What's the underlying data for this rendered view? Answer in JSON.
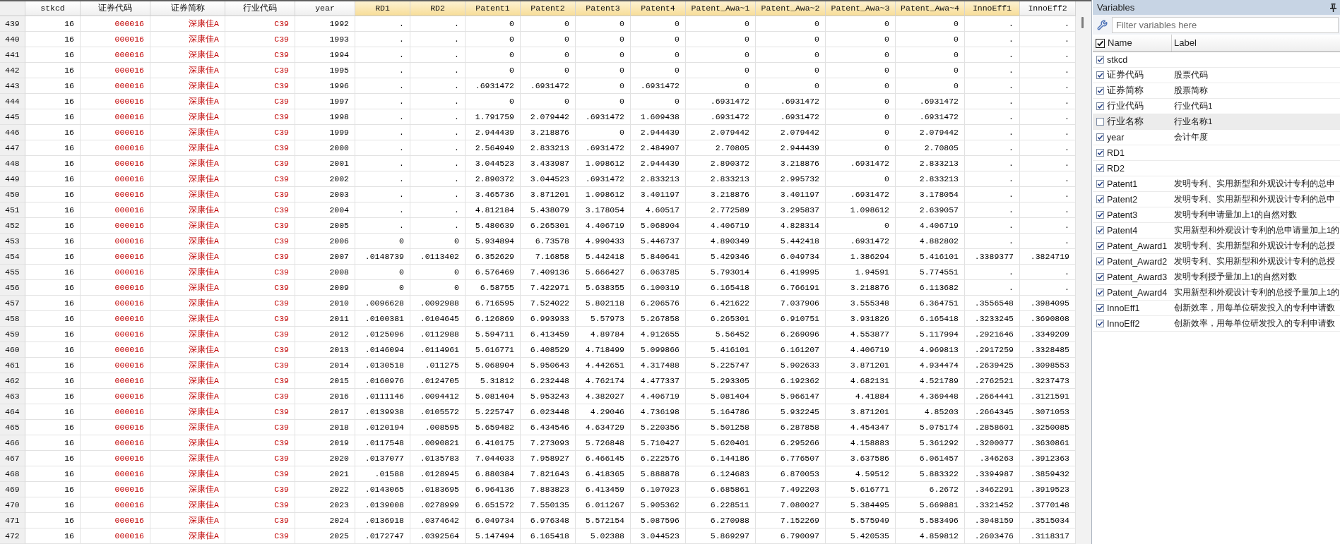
{
  "data_editor": {
    "columns": [
      {
        "name": "stkcd",
        "kind": "numeric",
        "selected": false
      },
      {
        "name": "证券代码",
        "kind": "string",
        "selected": false
      },
      {
        "name": "证券简称",
        "kind": "string",
        "selected": false
      },
      {
        "name": "行业代码",
        "kind": "string",
        "selected": false
      },
      {
        "name": "year",
        "kind": "numeric",
        "selected": false
      },
      {
        "name": "RD1",
        "kind": "numeric",
        "selected": true
      },
      {
        "name": "RD2",
        "kind": "numeric",
        "selected": true
      },
      {
        "name": "Patent1",
        "kind": "numeric",
        "selected": true
      },
      {
        "name": "Patent2",
        "kind": "numeric",
        "selected": true
      },
      {
        "name": "Patent3",
        "kind": "numeric",
        "selected": true
      },
      {
        "name": "Patent4",
        "kind": "numeric",
        "selected": true
      },
      {
        "name": "Patent_Awa~1",
        "kind": "numeric",
        "selected": true
      },
      {
        "name": "Patent_Awa~2",
        "kind": "numeric",
        "selected": true
      },
      {
        "name": "Patent_Awa~3",
        "kind": "numeric",
        "selected": true
      },
      {
        "name": "Patent_Awa~4",
        "kind": "numeric",
        "selected": true
      },
      {
        "name": "InnoEff1",
        "kind": "numeric",
        "selected": true
      },
      {
        "name": "InnoEff2",
        "kind": "numeric",
        "selected": false
      }
    ],
    "rows": [
      {
        "number": "439",
        "cells": [
          "16",
          "000016",
          "深康佳A",
          "C39",
          "1992",
          ".",
          ".",
          "0",
          "0",
          "0",
          "0",
          "0",
          "0",
          "0",
          "0",
          ".",
          "."
        ]
      },
      {
        "number": "440",
        "cells": [
          "16",
          "000016",
          "深康佳A",
          "C39",
          "1993",
          ".",
          ".",
          "0",
          "0",
          "0",
          "0",
          "0",
          "0",
          "0",
          "0",
          ".",
          "."
        ]
      },
      {
        "number": "441",
        "cells": [
          "16",
          "000016",
          "深康佳A",
          "C39",
          "1994",
          ".",
          ".",
          "0",
          "0",
          "0",
          "0",
          "0",
          "0",
          "0",
          "0",
          ".",
          "."
        ]
      },
      {
        "number": "442",
        "cells": [
          "16",
          "000016",
          "深康佳A",
          "C39",
          "1995",
          ".",
          ".",
          "0",
          "0",
          "0",
          "0",
          "0",
          "0",
          "0",
          "0",
          ".",
          "."
        ]
      },
      {
        "number": "443",
        "cells": [
          "16",
          "000016",
          "深康佳A",
          "C39",
          "1996",
          ".",
          ".",
          ".6931472",
          ".6931472",
          "0",
          ".6931472",
          "0",
          "0",
          "0",
          "0",
          ".",
          "."
        ]
      },
      {
        "number": "444",
        "cells": [
          "16",
          "000016",
          "深康佳A",
          "C39",
          "1997",
          ".",
          ".",
          "0",
          "0",
          "0",
          "0",
          ".6931472",
          ".6931472",
          "0",
          ".6931472",
          ".",
          "."
        ]
      },
      {
        "number": "445",
        "cells": [
          "16",
          "000016",
          "深康佳A",
          "C39",
          "1998",
          ".",
          ".",
          "1.791759",
          "2.079442",
          ".6931472",
          "1.609438",
          ".6931472",
          ".6931472",
          "0",
          ".6931472",
          ".",
          "."
        ]
      },
      {
        "number": "446",
        "cells": [
          "16",
          "000016",
          "深康佳A",
          "C39",
          "1999",
          ".",
          ".",
          "2.944439",
          "3.218876",
          "0",
          "2.944439",
          "2.079442",
          "2.079442",
          "0",
          "2.079442",
          ".",
          "."
        ]
      },
      {
        "number": "447",
        "cells": [
          "16",
          "000016",
          "深康佳A",
          "C39",
          "2000",
          ".",
          ".",
          "2.564949",
          "2.833213",
          ".6931472",
          "2.484907",
          "2.70805",
          "2.944439",
          "0",
          "2.70805",
          ".",
          "."
        ]
      },
      {
        "number": "448",
        "cells": [
          "16",
          "000016",
          "深康佳A",
          "C39",
          "2001",
          ".",
          ".",
          "3.044523",
          "3.433987",
          "1.098612",
          "2.944439",
          "2.890372",
          "3.218876",
          ".6931472",
          "2.833213",
          ".",
          "."
        ]
      },
      {
        "number": "449",
        "cells": [
          "16",
          "000016",
          "深康佳A",
          "C39",
          "2002",
          ".",
          ".",
          "2.890372",
          "3.044523",
          ".6931472",
          "2.833213",
          "2.833213",
          "2.995732",
          "0",
          "2.833213",
          ".",
          "."
        ]
      },
      {
        "number": "450",
        "cells": [
          "16",
          "000016",
          "深康佳A",
          "C39",
          "2003",
          ".",
          ".",
          "3.465736",
          "3.871201",
          "1.098612",
          "3.401197",
          "3.218876",
          "3.401197",
          ".6931472",
          "3.178054",
          ".",
          "."
        ]
      },
      {
        "number": "451",
        "cells": [
          "16",
          "000016",
          "深康佳A",
          "C39",
          "2004",
          ".",
          ".",
          "4.812184",
          "5.438079",
          "3.178054",
          "4.60517",
          "2.772589",
          "3.295837",
          "1.098612",
          "2.639057",
          ".",
          "."
        ]
      },
      {
        "number": "452",
        "cells": [
          "16",
          "000016",
          "深康佳A",
          "C39",
          "2005",
          ".",
          ".",
          "5.480639",
          "6.265301",
          "4.406719",
          "5.068904",
          "4.406719",
          "4.828314",
          "0",
          "4.406719",
          ".",
          "."
        ]
      },
      {
        "number": "453",
        "cells": [
          "16",
          "000016",
          "深康佳A",
          "C39",
          "2006",
          "0",
          "0",
          "5.934894",
          "6.73578",
          "4.990433",
          "5.446737",
          "4.890349",
          "5.442418",
          ".6931472",
          "4.882802",
          ".",
          "."
        ]
      },
      {
        "number": "454",
        "cells": [
          "16",
          "000016",
          "深康佳A",
          "C39",
          "2007",
          ".0148739",
          ".0113402",
          "6.352629",
          "7.16858",
          "5.442418",
          "5.840641",
          "5.429346",
          "6.049734",
          "1.386294",
          "5.416101",
          ".3389377",
          ".3824719"
        ]
      },
      {
        "number": "455",
        "cells": [
          "16",
          "000016",
          "深康佳A",
          "C39",
          "2008",
          "0",
          "0",
          "6.576469",
          "7.409136",
          "5.666427",
          "6.063785",
          "5.793014",
          "6.419995",
          "1.94591",
          "5.774551",
          ".",
          "."
        ]
      },
      {
        "number": "456",
        "cells": [
          "16",
          "000016",
          "深康佳A",
          "C39",
          "2009",
          "0",
          "0",
          "6.58755",
          "7.422971",
          "5.638355",
          "6.100319",
          "6.165418",
          "6.766191",
          "3.218876",
          "6.113682",
          ".",
          "."
        ]
      },
      {
        "number": "457",
        "cells": [
          "16",
          "000016",
          "深康佳A",
          "C39",
          "2010",
          ".0096628",
          ".0092988",
          "6.716595",
          "7.524022",
          "5.802118",
          "6.206576",
          "6.421622",
          "7.037906",
          "3.555348",
          "6.364751",
          ".3556548",
          ".3984095"
        ]
      },
      {
        "number": "458",
        "cells": [
          "16",
          "000016",
          "深康佳A",
          "C39",
          "2011",
          ".0100381",
          ".0104645",
          "6.126869",
          "6.993933",
          "5.57973",
          "5.267858",
          "6.265301",
          "6.910751",
          "3.931826",
          "6.165418",
          ".3233245",
          ".3690808"
        ]
      },
      {
        "number": "459",
        "cells": [
          "16",
          "000016",
          "深康佳A",
          "C39",
          "2012",
          ".0125096",
          ".0112988",
          "5.594711",
          "6.413459",
          "4.89784",
          "4.912655",
          "5.56452",
          "6.269096",
          "4.553877",
          "5.117994",
          ".2921646",
          ".3349209"
        ]
      },
      {
        "number": "460",
        "cells": [
          "16",
          "000016",
          "深康佳A",
          "C39",
          "2013",
          ".0146094",
          ".0114961",
          "5.616771",
          "6.408529",
          "4.718499",
          "5.099866",
          "5.416101",
          "6.161207",
          "4.406719",
          "4.969813",
          ".2917259",
          ".3328485"
        ]
      },
      {
        "number": "461",
        "cells": [
          "16",
          "000016",
          "深康佳A",
          "C39",
          "2014",
          ".0130518",
          ".011275",
          "5.068904",
          "5.950643",
          "4.442651",
          "4.317488",
          "5.225747",
          "5.902633",
          "3.871201",
          "4.934474",
          ".2639425",
          ".3098553"
        ]
      },
      {
        "number": "462",
        "cells": [
          "16",
          "000016",
          "深康佳A",
          "C39",
          "2015",
          ".0160976",
          ".0124705",
          "5.31812",
          "6.232448",
          "4.762174",
          "4.477337",
          "5.293305",
          "6.192362",
          "4.682131",
          "4.521789",
          ".2762521",
          ".3237473"
        ]
      },
      {
        "number": "463",
        "cells": [
          "16",
          "000016",
          "深康佳A",
          "C39",
          "2016",
          ".0111146",
          ".0094412",
          "5.081404",
          "5.953243",
          "4.382027",
          "4.406719",
          "5.081404",
          "5.966147",
          "4.41884",
          "4.369448",
          ".2664441",
          ".3121591"
        ]
      },
      {
        "number": "464",
        "cells": [
          "16",
          "000016",
          "深康佳A",
          "C39",
          "2017",
          ".0139938",
          ".0105572",
          "5.225747",
          "6.023448",
          "4.29046",
          "4.736198",
          "5.164786",
          "5.932245",
          "3.871201",
          "4.85203",
          ".2664345",
          ".3071053"
        ]
      },
      {
        "number": "465",
        "cells": [
          "16",
          "000016",
          "深康佳A",
          "C39",
          "2018",
          ".0120194",
          ".008595",
          "5.659482",
          "6.434546",
          "4.634729",
          "5.220356",
          "5.501258",
          "6.287858",
          "4.454347",
          "5.075174",
          ".2858601",
          ".3250085"
        ]
      },
      {
        "number": "466",
        "cells": [
          "16",
          "000016",
          "深康佳A",
          "C39",
          "2019",
          ".0117548",
          ".0090821",
          "6.410175",
          "7.273093",
          "5.726848",
          "5.710427",
          "5.620401",
          "6.295266",
          "4.158883",
          "5.361292",
          ".3200077",
          ".3630861"
        ]
      },
      {
        "number": "467",
        "cells": [
          "16",
          "000016",
          "深康佳A",
          "C39",
          "2020",
          ".0137077",
          ".0135783",
          "7.044033",
          "7.958927",
          "6.466145",
          "6.222576",
          "6.144186",
          "6.776507",
          "3.637586",
          "6.061457",
          ".346263",
          ".3912363"
        ]
      },
      {
        "number": "468",
        "cells": [
          "16",
          "000016",
          "深康佳A",
          "C39",
          "2021",
          ".01588",
          ".0128945",
          "6.880384",
          "7.821643",
          "6.418365",
          "5.888878",
          "6.124683",
          "6.870053",
          "4.59512",
          "5.883322",
          ".3394987",
          ".3859432"
        ]
      },
      {
        "number": "469",
        "cells": [
          "16",
          "000016",
          "深康佳A",
          "C39",
          "2022",
          ".0143065",
          ".0183695",
          "6.964136",
          "7.883823",
          "6.413459",
          "6.107023",
          "6.685861",
          "7.492203",
          "5.616771",
          "6.2672",
          ".3462291",
          ".3919523"
        ]
      },
      {
        "number": "470",
        "cells": [
          "16",
          "000016",
          "深康佳A",
          "C39",
          "2023",
          ".0139008",
          ".0278999",
          "6.651572",
          "7.550135",
          "6.011267",
          "5.905362",
          "6.228511",
          "7.080027",
          "5.384495",
          "5.669881",
          ".3321452",
          ".3770148"
        ]
      },
      {
        "number": "471",
        "cells": [
          "16",
          "000016",
          "深康佳A",
          "C39",
          "2024",
          ".0136918",
          ".0374642",
          "6.049734",
          "6.976348",
          "5.572154",
          "5.087596",
          "6.270988",
          "7.152269",
          "5.575949",
          "5.583496",
          ".3048159",
          ".3515034"
        ]
      },
      {
        "number": "472",
        "cells": [
          "16",
          "000016",
          "深康佳A",
          "C39",
          "2025",
          ".0172747",
          ".0392564",
          "5.147494",
          "6.165418",
          "5.02388",
          "3.044523",
          "5.869297",
          "6.790097",
          "5.420535",
          "4.859812",
          ".2603476",
          ".3118317"
        ]
      }
    ]
  },
  "variables_window": {
    "title": "Variables",
    "filter": {
      "placeholder": "Filter variables here"
    },
    "header": {
      "all_checked": true,
      "name": "Name",
      "label": "Label"
    },
    "variables": [
      {
        "name": "stkcd",
        "checked": true,
        "selected": false
      },
      {
        "name": "证券代码",
        "label": "股票代码",
        "checked": true,
        "selected": false
      },
      {
        "name": "证券简称",
        "label": "股票简称",
        "checked": true,
        "selected": false
      },
      {
        "name": "行业代码",
        "label": "行业代码1",
        "checked": true,
        "selected": false
      },
      {
        "name": "行业名称",
        "label": "行业名称1",
        "checked": false,
        "selected": true
      },
      {
        "name": "year",
        "label": "会计年度",
        "checked": true,
        "selected": false
      },
      {
        "name": "RD1",
        "checked": true,
        "selected": false
      },
      {
        "name": "RD2",
        "checked": true,
        "selected": false
      },
      {
        "name": "Patent1",
        "label": "发明专利、实用新型和外观设计专利的总申",
        "checked": true,
        "selected": false
      },
      {
        "name": "Patent2",
        "label": "发明专利、实用新型和外观设计专利的总申",
        "checked": true,
        "selected": false
      },
      {
        "name": "Patent3",
        "label": "发明专利申请量加上1的自然对数",
        "checked": true,
        "selected": false
      },
      {
        "name": "Patent4",
        "label": "实用新型和外观设计专利的总申请量加上1的",
        "checked": true,
        "selected": false
      },
      {
        "name": "Patent_Award1",
        "label": "发明专利、实用新型和外观设计专利的总授",
        "checked": true,
        "selected": false
      },
      {
        "name": "Patent_Award2",
        "label": "发明专利、实用新型和外观设计专利的总授",
        "checked": true,
        "selected": false
      },
      {
        "name": "Patent_Award3",
        "label": "发明专利授予量加上1的自然对数",
        "checked": true,
        "selected": false
      },
      {
        "name": "Patent_Award4",
        "label": "实用新型和外观设计专利的总授予量加上1的",
        "checked": true,
        "selected": false
      },
      {
        "name": "InnoEff1",
        "label": "创新效率，用每单位研发投入的专利申请数",
        "checked": true,
        "selected": false
      },
      {
        "name": "InnoEff2",
        "label": "创新效率，用每单位研发投入的专利申请数",
        "checked": true,
        "selected": false
      }
    ]
  }
}
